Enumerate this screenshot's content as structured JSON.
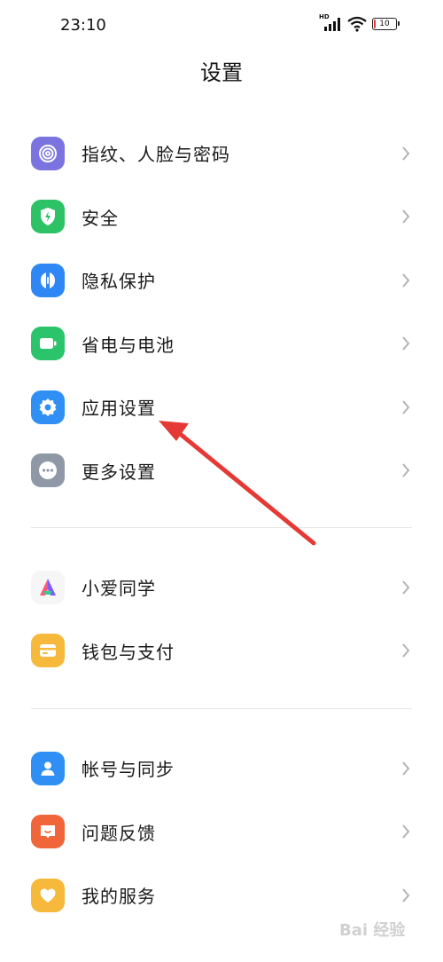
{
  "status_bar": {
    "time": "23:10",
    "network": "HD",
    "battery": "10"
  },
  "page": {
    "title": "设置"
  },
  "groups": [
    [
      {
        "label": "指纹、人脸与密码",
        "icon": "fingerprint-icon",
        "color": "#7b74e0"
      },
      {
        "label": "安全",
        "icon": "shield-bolt-icon",
        "color": "#2ec266"
      },
      {
        "label": "隐私保护",
        "icon": "privacy-icon",
        "color": "#2f87f5"
      },
      {
        "label": "省电与电池",
        "icon": "battery-icon",
        "color": "#2bc46a"
      },
      {
        "label": "应用设置",
        "icon": "gear-icon",
        "color": "#2f8ff5"
      },
      {
        "label": "更多设置",
        "icon": "more-icon",
        "color": "#8e98a6"
      }
    ],
    [
      {
        "label": "小爱同学",
        "icon": "xiaoai-icon",
        "color": "#f6f6f6"
      },
      {
        "label": "钱包与支付",
        "icon": "wallet-icon",
        "color": "#f6b93b"
      }
    ],
    [
      {
        "label": "帐号与同步",
        "icon": "account-icon",
        "color": "#2f8ff5"
      },
      {
        "label": "问题反馈",
        "icon": "feedback-icon",
        "color": "#f0653a"
      },
      {
        "label": "我的服务",
        "icon": "service-heart-icon",
        "color": "#f6b93b"
      }
    ]
  ],
  "annotation": {
    "color": "#e53935"
  },
  "watermark": "Bai 经验"
}
